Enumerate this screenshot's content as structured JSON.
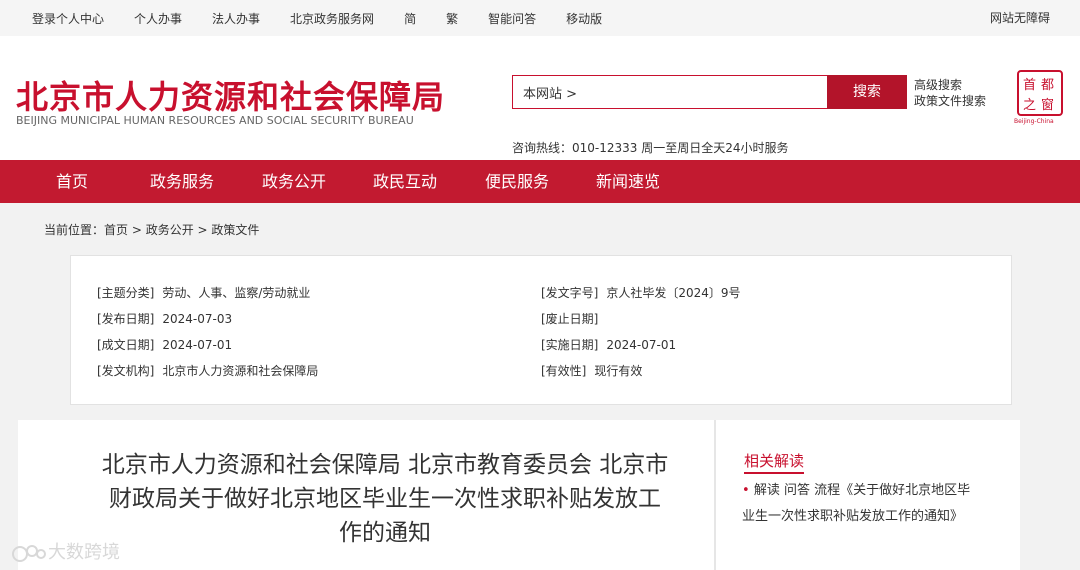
{
  "topbar": {
    "links": [
      "登录个人中心",
      "个人办事",
      "法人办事",
      "北京政务服务网",
      "简",
      "繁",
      "智能问答",
      "移动版"
    ],
    "accessibility": "网站无障碍"
  },
  "header": {
    "logo_cn": "北京市人力资源和社会保障局",
    "logo_en": "BEIJING MUNICIPAL HUMAN RESOURCES AND SOCIAL SECURITY BUREAU",
    "search_value": "本网站 >",
    "search_button": "搜索",
    "advanced_search": "高级搜索",
    "policy_search": "政策文件搜索",
    "hotline": "咨询热线：010-12333 周一至周日全天24小时服务",
    "seal": {
      "c1": "首",
      "c2": "都",
      "c3": "之",
      "c4": "窗",
      "caption": "Beijing-China"
    }
  },
  "nav": [
    "首页",
    "政务服务",
    "政务公开",
    "政民互动",
    "便民服务",
    "新闻速览"
  ],
  "breadcrumb": {
    "prefix": "当前位置：",
    "items": [
      "首页",
      "政务公开",
      "政策文件"
    ],
    "sep": " > "
  },
  "info": {
    "subject_label": "[主题分类]",
    "subject": "劳动、人事、监察/劳动就业",
    "docno_label": "[发文字号]",
    "docno": "京人社毕发〔2024〕9号",
    "publish_label": "[发布日期]",
    "publish": "2024-07-03",
    "expire_label": "[废止日期]",
    "expire": "",
    "written_label": "[成文日期]",
    "written": "2024-07-01",
    "effective_label": "[实施日期]",
    "effective": "2024-07-01",
    "org_label": "[发文机构]",
    "org": "北京市人力资源和社会保障局",
    "validity_label": "[有效性]",
    "validity": "现行有效"
  },
  "article": {
    "title": "北京市人力资源和社会保障局 北京市教育委员会 北京市财政局关于做好北京地区毕业生一次性求职补贴发放工作的通知"
  },
  "sidebar": {
    "title": "相关解读",
    "item": "解读 问答 流程《关于做好北京地区毕业生一次性求职补贴发放工作的通知》"
  },
  "watermark": "大数跨境",
  "colors": {
    "brand_red": "#c21a30",
    "accent_red": "#c8102e"
  }
}
